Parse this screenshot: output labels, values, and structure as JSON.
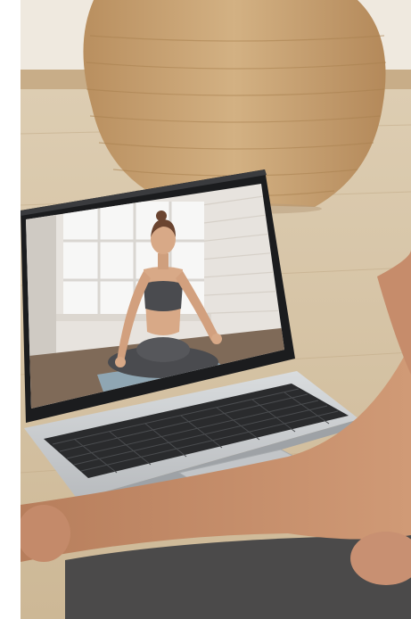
{
  "scene": {
    "subject": "laptop-showing-yoga-class",
    "palette": {
      "wall": "#efe9df",
      "floor": "#d6c4a6",
      "basket": "#c9a576",
      "laptop_body": "#cfd2d4",
      "keyboard": "#2a2b2d",
      "screen_bezel": "#1b1c1e",
      "video_wall": "#e7e3de",
      "yoga_mat": "#8fa6b3",
      "skin": "#d8a987",
      "clothing": "#4a4b4f"
    }
  }
}
